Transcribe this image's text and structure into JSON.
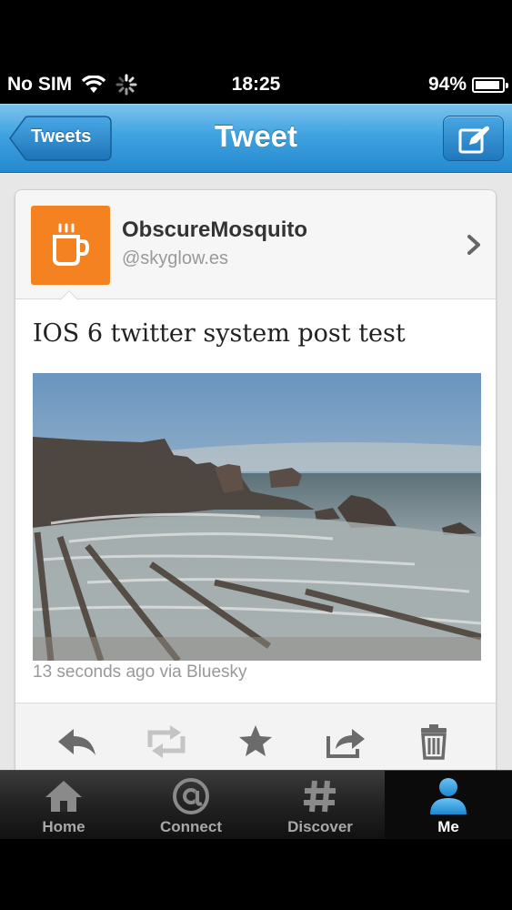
{
  "status_bar": {
    "carrier": "No SIM",
    "time": "18:25",
    "battery": "94%",
    "battery_level": 0.94,
    "icons": [
      "wifi-icon",
      "activity-spinner-icon",
      "battery-icon"
    ]
  },
  "nav": {
    "back_label": "Tweets",
    "title": "Tweet",
    "compose_icon": "compose-icon"
  },
  "tweet": {
    "display_name": "ObscureMosquito",
    "handle": "@skyglow.es",
    "avatar_icon": "coffee-mug-icon",
    "text": "IOS 6 twitter system post test",
    "photo": "coastal-rocks-seascape",
    "meta": "13 seconds ago via Bluesky"
  },
  "actions": [
    "reply-icon",
    "retweet-icon",
    "favorite-star-icon",
    "share-icon",
    "delete-trash-icon"
  ],
  "tabs": [
    {
      "label": "Home",
      "icon": "home-icon",
      "active": false
    },
    {
      "label": "Connect",
      "icon": "at-sign-icon",
      "active": false
    },
    {
      "label": "Discover",
      "icon": "hashtag-icon",
      "active": false
    },
    {
      "label": "Me",
      "icon": "person-icon",
      "active": true
    }
  ],
  "colors": {
    "nav_blue": "#2489cf",
    "avatar_orange": "#f58220",
    "active_tab_blue": "#2f9bdc"
  }
}
